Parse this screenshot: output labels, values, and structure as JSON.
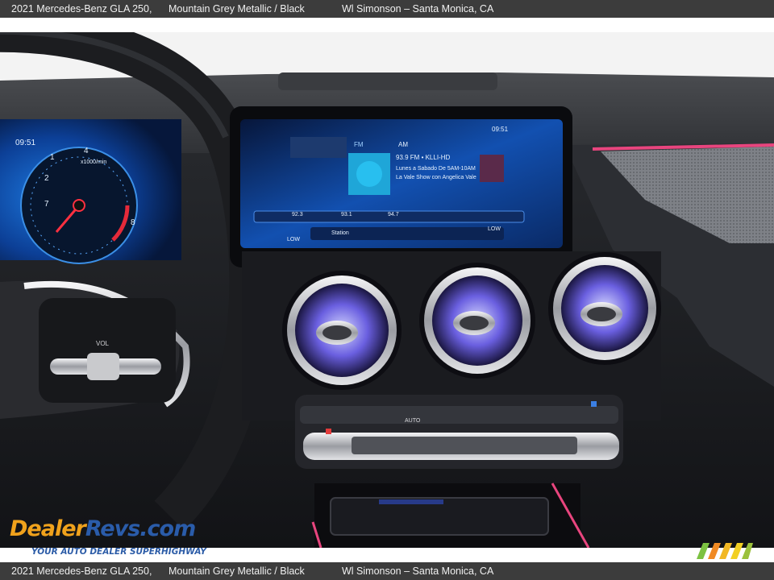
{
  "caption": {
    "model": "2021 Mercedes-Benz GLA 250,",
    "color": "Mountain Grey Metallic / Black",
    "dealer": "Wl Simonson – Santa Monica, CA"
  },
  "watermark": {
    "logo_part1": "Dealer",
    "logo_part2": "Revs",
    "logo_part3": ".com",
    "tagline": "YOUR AUTO DEALER SUPERHIGHWAY"
  },
  "screen": {
    "time": "09:51",
    "band_fm": "FM",
    "band_am": "AM",
    "station_title": "93.9 FM • KLLI-HD",
    "show_line1": "Lunes a Sabado De 5AM-10AM",
    "show_line2": "La Vale Show con Angelica Vale",
    "station_button": "Station",
    "low_left": "LOW",
    "low_right": "LOW",
    "presets": [
      "92.3",
      "93.1",
      "94.7"
    ]
  },
  "cluster": {
    "time": "09:51",
    "rpm_label": "x1000/min",
    "ticks": [
      "1",
      "2",
      "4",
      "7",
      "8"
    ]
  },
  "steering": {
    "vol_label": "VOL"
  },
  "climate": {
    "auto_label": "AUTO"
  },
  "colors": {
    "caption_bar": "#3c3c3c",
    "ambient_pink": "#e8457e",
    "screen_blue": "#1f6fd6",
    "logo_orange": "#f0a21c",
    "logo_blue": "#2a5caa"
  }
}
